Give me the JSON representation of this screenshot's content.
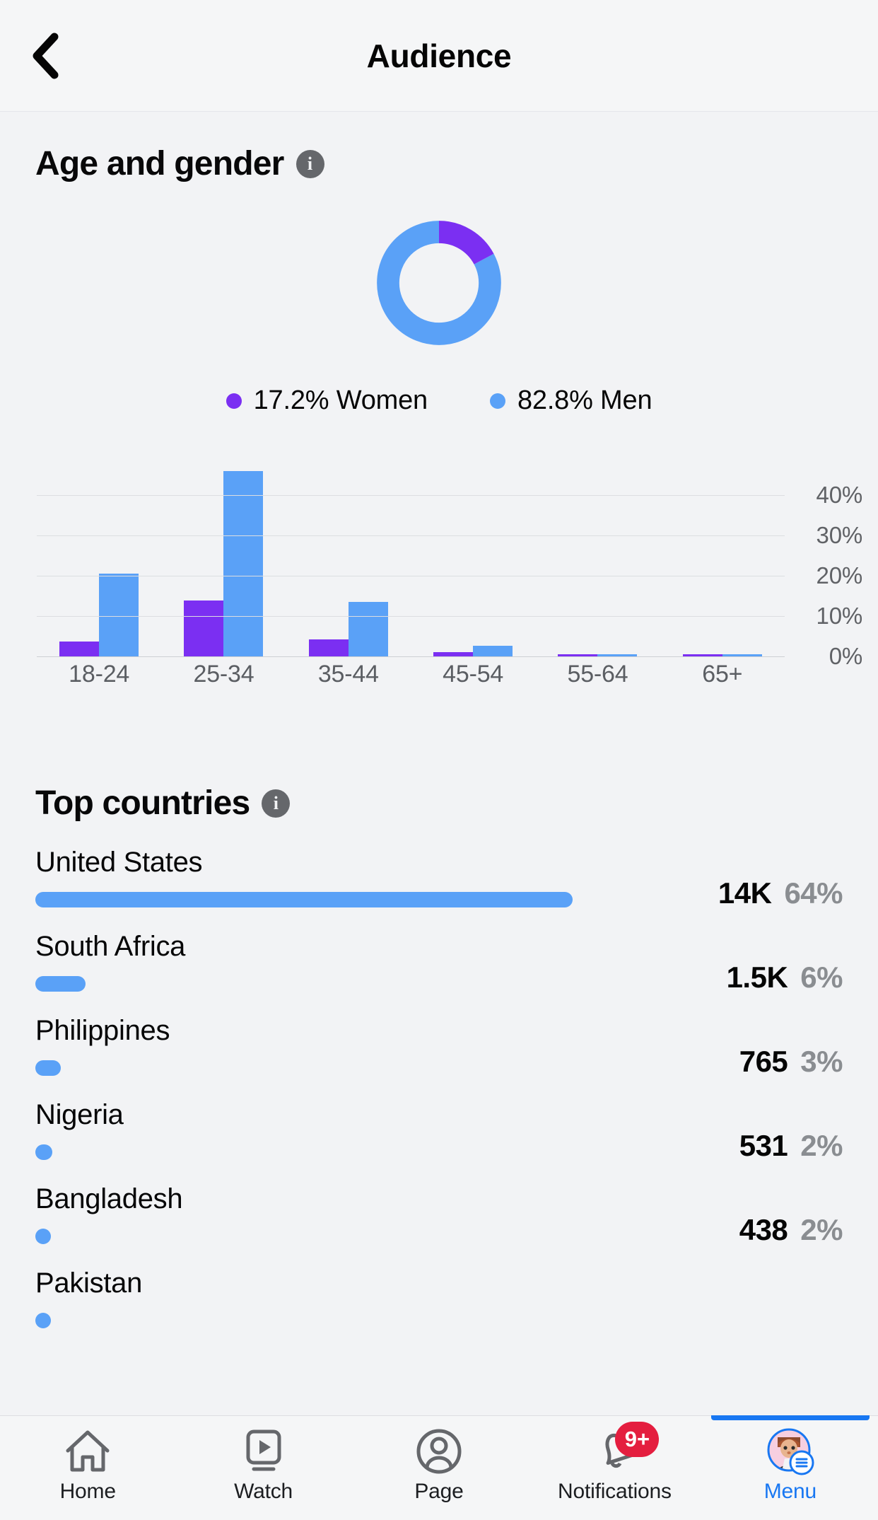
{
  "header": {
    "title": "Audience",
    "back_icon": "chevron-left-icon"
  },
  "age_gender": {
    "title": "Age and gender",
    "info_icon": "info-icon",
    "info_glyph": "i",
    "donut": {
      "women_pct": 17.2,
      "men_pct": 82.8,
      "women_color": "#7b2ff2",
      "men_color": "#5aa1f7"
    },
    "legend": [
      {
        "label": "17.2%  Women",
        "color": "#7b2ff2",
        "name": "women"
      },
      {
        "label": "82.8%  Men",
        "color": "#5aa1f7",
        "name": "men"
      }
    ]
  },
  "chart_data": {
    "type": "bar",
    "title": "Age and gender",
    "xlabel": "",
    "ylabel": "",
    "categories": [
      "18-24",
      "25-34",
      "35-44",
      "45-54",
      "55-64",
      "65+"
    ],
    "series": [
      {
        "name": "Women",
        "color": "#7b2ff2",
        "values": [
          3.7,
          13.8,
          4.2,
          1.0,
          0.3,
          0.3
        ]
      },
      {
        "name": "Men",
        "color": "#5aa1f7",
        "values": [
          20.6,
          46.0,
          13.5,
          2.6,
          0.4,
          0.5
        ]
      }
    ],
    "ylim": [
      0,
      47
    ],
    "yticks": [
      0,
      10,
      20,
      30,
      40
    ],
    "ytick_labels": [
      "0%",
      "10%",
      "20%",
      "30%",
      "40%"
    ],
    "grid": true,
    "legend_position": "top"
  },
  "top_countries": {
    "title": "Top countries",
    "info_icon": "info-icon",
    "info_glyph": "i",
    "bar_color": "#5aa1f7",
    "rows": [
      {
        "country": "United States",
        "value": "14K",
        "pct": "64%",
        "bar_ratio": 1.0
      },
      {
        "country": "South Africa",
        "value": "1.5K",
        "pct": "6%",
        "bar_ratio": 0.094
      },
      {
        "country": "Philippines",
        "value": "765",
        "pct": "3%",
        "bar_ratio": 0.047
      },
      {
        "country": "Nigeria",
        "value": "531",
        "pct": "2%",
        "bar_ratio": 0.031
      },
      {
        "country": "Bangladesh",
        "value": "438",
        "pct": "2%",
        "bar_ratio": 0.029
      },
      {
        "country": "Pakistan",
        "value": "",
        "pct": "",
        "bar_ratio": 0.02
      }
    ]
  },
  "tabbar": {
    "active": "Menu",
    "tabs": [
      {
        "label": "Home",
        "icon": "home-icon",
        "badge": ""
      },
      {
        "label": "Watch",
        "icon": "watch-icon",
        "badge": ""
      },
      {
        "label": "Page",
        "icon": "profile-icon",
        "badge": ""
      },
      {
        "label": "Notifications",
        "icon": "bell-icon",
        "badge": "9+"
      },
      {
        "label": "Menu",
        "icon": "avatar-menu-icon",
        "badge": ""
      }
    ]
  }
}
